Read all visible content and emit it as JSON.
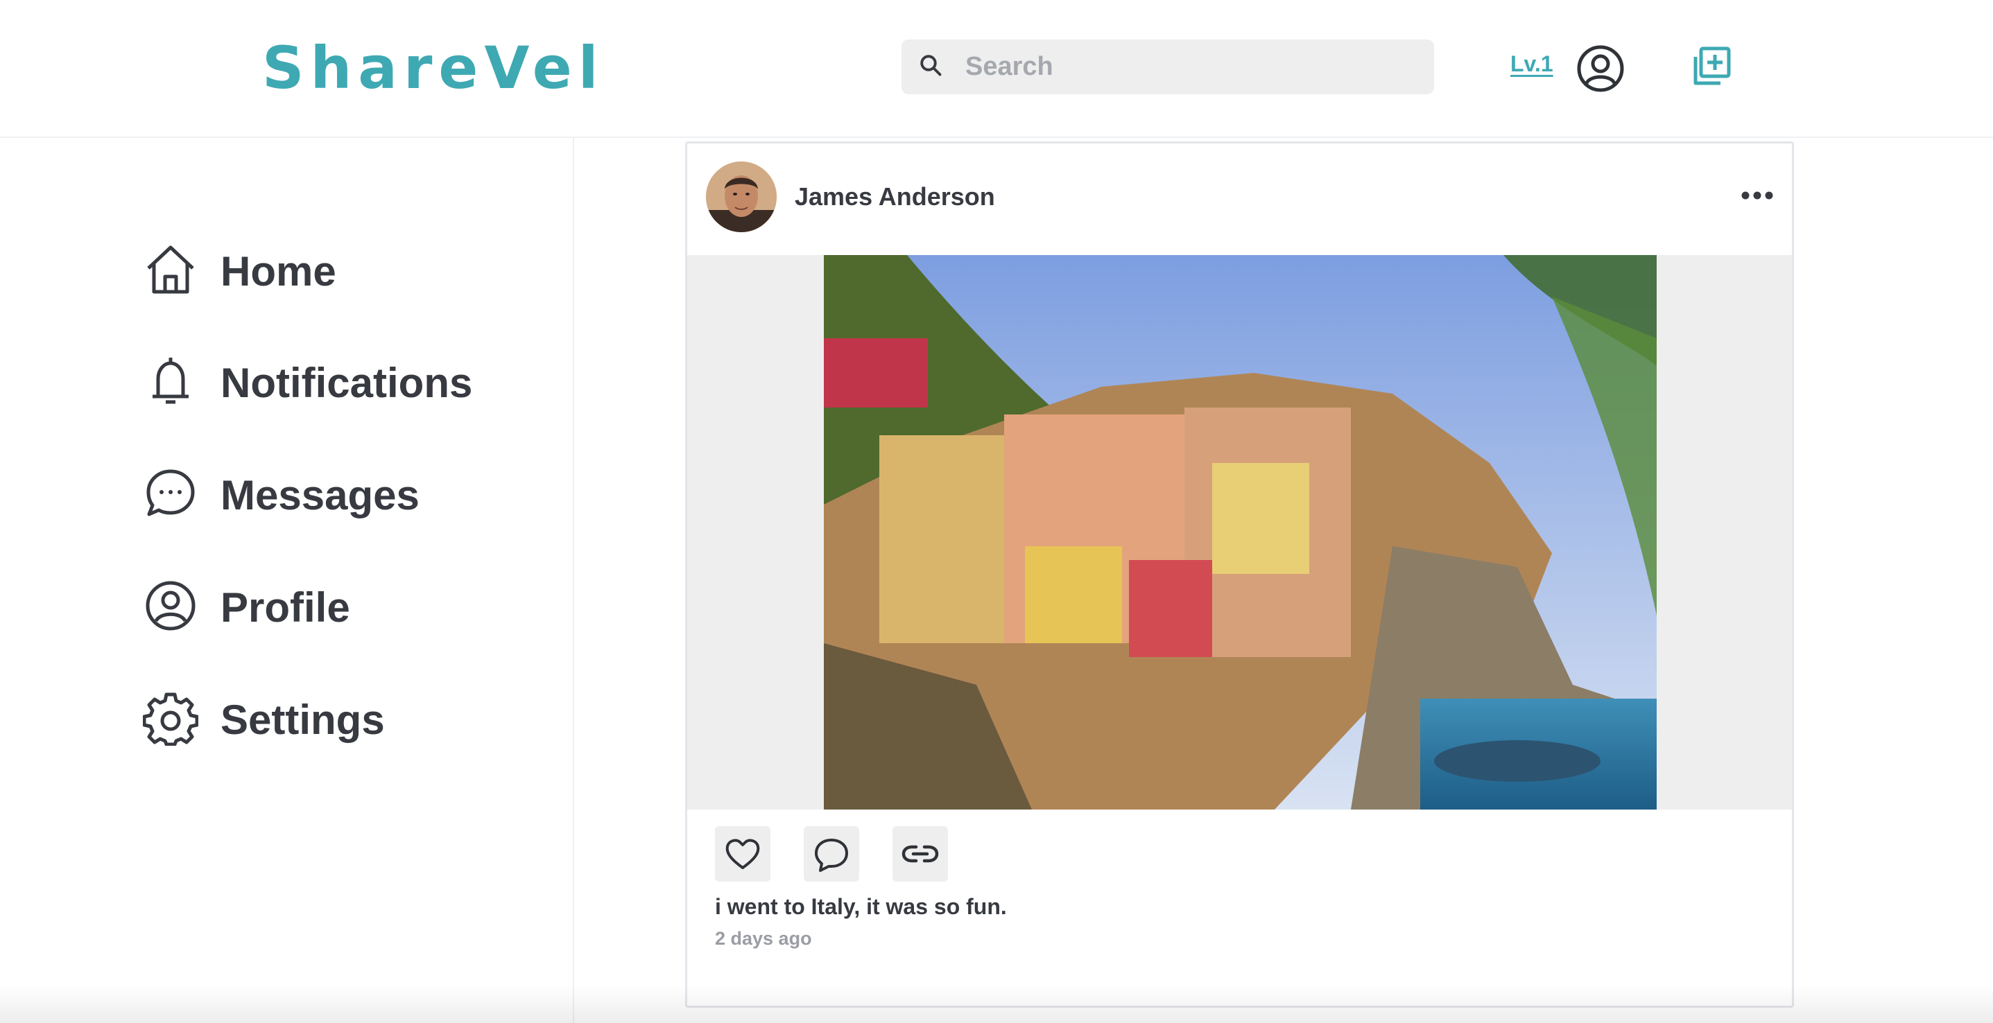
{
  "header": {
    "logo": "ShareVel",
    "search_placeholder": "Search",
    "level_label": "Lv.1",
    "account_icon": "user-circle-icon",
    "create_icon": "add-post-icon"
  },
  "sidebar": {
    "items": [
      {
        "label": "Home",
        "icon": "home-icon"
      },
      {
        "label": "Notifications",
        "icon": "bell-icon"
      },
      {
        "label": "Messages",
        "icon": "chat-bubble-icon"
      },
      {
        "label": "Profile",
        "icon": "profile-icon"
      },
      {
        "label": "Settings",
        "icon": "gear-icon"
      }
    ]
  },
  "post": {
    "author": "James Anderson",
    "caption": "i went to Italy, it was so fun.",
    "timestamp": "2 days ago",
    "actions": [
      "like-heart-icon",
      "comment-icon",
      "share-link-icon"
    ]
  },
  "colors": {
    "brand": "#3ea9b3",
    "text": "#373a40",
    "muted": "#9a9da3",
    "surface": "#eeeeee"
  }
}
